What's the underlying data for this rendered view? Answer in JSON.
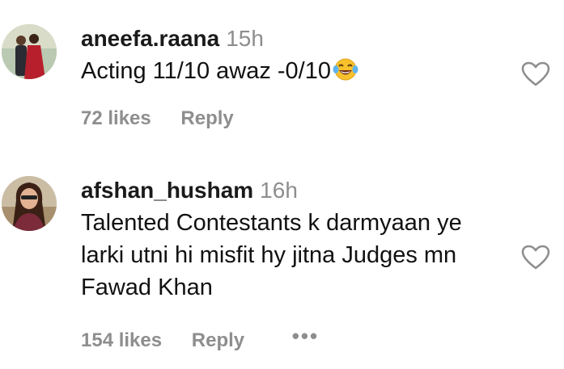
{
  "comments": [
    {
      "username": "aneefa.raana",
      "time": "15h",
      "text": "Acting 11/10 awaz -0/10",
      "emoji": "tears-of-joy-emoji",
      "likes": "72 likes",
      "reply": "Reply"
    },
    {
      "username": "afshan_husham",
      "time": "16h",
      "text_lines": [
        "Talented Contestants k darmyaan ye",
        "larki utni hi misfit hy jitna Judges mn",
        "Fawad Khan"
      ],
      "likes": "154 likes",
      "reply": "Reply",
      "more": "•••"
    }
  ],
  "icons": {
    "like": "heart-outline-icon"
  },
  "colors": {
    "secondary_text": "#8e8e8e",
    "primary_text": "#111111"
  }
}
